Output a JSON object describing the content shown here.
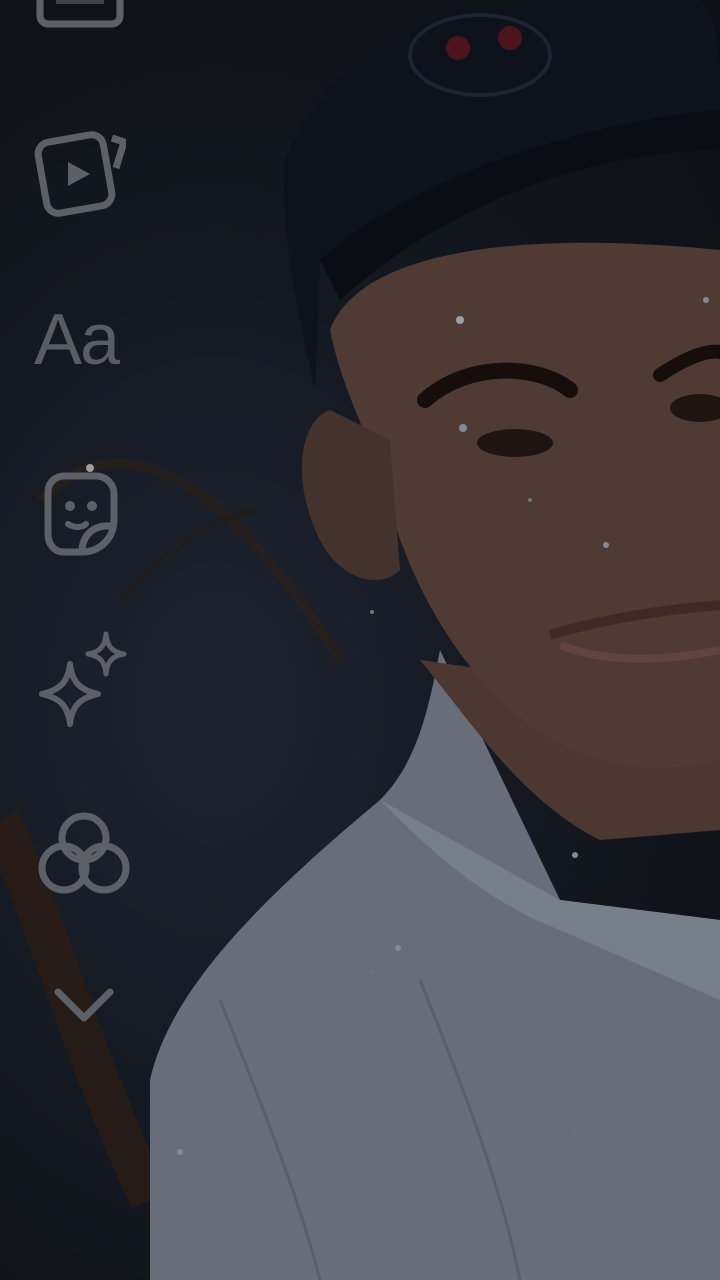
{
  "screen": {
    "type": "story-editor",
    "accent": "#5e6068"
  },
  "toolbar": {
    "items": [
      {
        "id": "gallery",
        "icon": "gallery-icon"
      },
      {
        "id": "reels",
        "icon": "reels-icon"
      },
      {
        "id": "text",
        "icon": "text-icon",
        "label": "Aa"
      },
      {
        "id": "stickers",
        "icon": "sticker-icon"
      },
      {
        "id": "effects",
        "icon": "sparkles-icon"
      },
      {
        "id": "filters",
        "icon": "filters-icon"
      },
      {
        "id": "more",
        "icon": "chevron-down-icon"
      }
    ]
  }
}
